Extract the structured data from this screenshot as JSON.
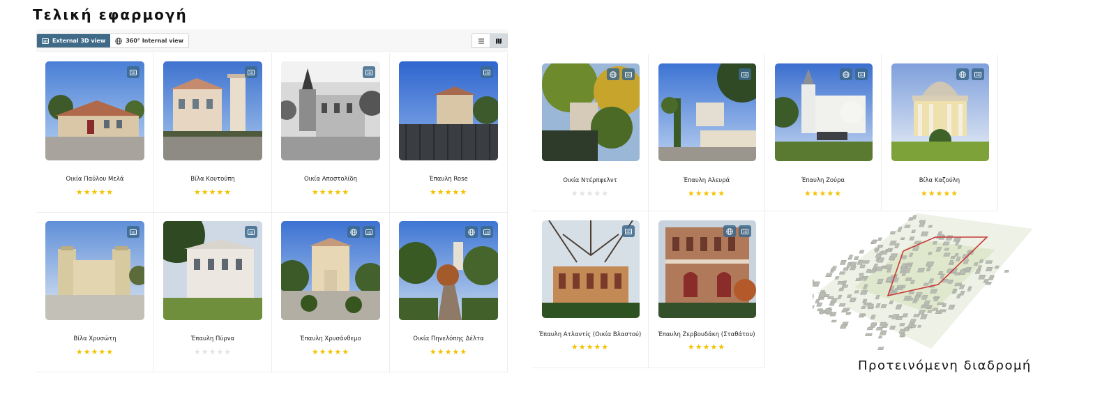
{
  "page_title": "Τελική εφαρμογή",
  "toolbar": {
    "external_3d_label": "External 3D view",
    "internal_360_label": "360° Internal view"
  },
  "left_cards": [
    {
      "name": "Οικία Παύλου Μελά",
      "rating": 5,
      "has_360": false
    },
    {
      "name": "Βίλα Κουτούπη",
      "rating": 5,
      "has_360": false
    },
    {
      "name": "Οικία Αποστολίδη",
      "rating": 5,
      "has_360": false
    },
    {
      "name": "Έπαυλη Rose",
      "rating": 5,
      "has_360": false
    },
    {
      "name": "Βίλα Χρυσώτη",
      "rating": 5,
      "has_360": false
    },
    {
      "name": "Έπαυλη Πύρνα",
      "rating": 0,
      "has_360": false
    },
    {
      "name": "Έπαυλη Χρυσάνθεμο",
      "rating": 5,
      "has_360": true
    },
    {
      "name": "Οικία Πηνελόπης Δέλτα",
      "rating": 5,
      "has_360": true
    }
  ],
  "right_cards": [
    {
      "name": "Οικία Ντέρπφελντ",
      "rating": 0,
      "has_360": true
    },
    {
      "name": "Έπαυλη Αλευρά",
      "rating": 5,
      "has_360": false
    },
    {
      "name": "Έπαυλη Ζούρα",
      "rating": 5,
      "has_360": true
    },
    {
      "name": "Βίλα Καζούλη",
      "rating": 5,
      "has_360": true
    },
    {
      "name": "Έπαυλη Ατλαντίς (Οικία Βλαστού)",
      "rating": 5,
      "has_360": false
    },
    {
      "name": "Έπαυλη Ζερβουδάκη (Σταθάτου)",
      "rating": 5,
      "has_360": true
    }
  ],
  "route": {
    "caption": "Προτεινόμενη διαδρομή"
  },
  "colors": {
    "accent": "#3f6b88",
    "star": "#f2c200",
    "star_off": "#e2e2e2"
  }
}
